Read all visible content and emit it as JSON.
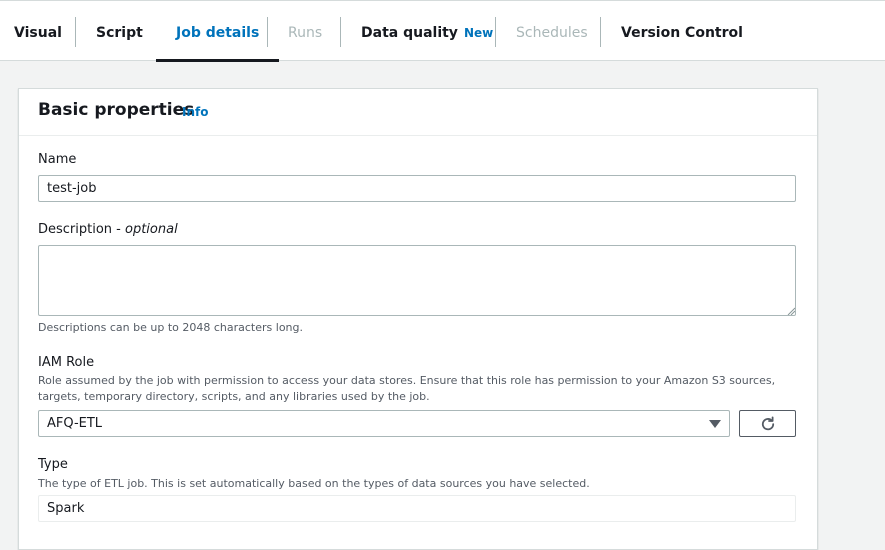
{
  "tabs": [
    {
      "label": "Visual",
      "state": "normal"
    },
    {
      "label": "Script",
      "state": "normal"
    },
    {
      "label": "Job details",
      "state": "active"
    },
    {
      "label": "Runs",
      "state": "disabled"
    },
    {
      "label": "Data quality",
      "state": "normal",
      "badge": "New"
    },
    {
      "label": "Schedules",
      "state": "disabled"
    },
    {
      "label": "Version Control",
      "state": "normal"
    }
  ],
  "panel": {
    "title": "Basic properties",
    "info_link": "Info"
  },
  "form": {
    "name": {
      "label": "Name",
      "value": "test-job"
    },
    "description": {
      "label": "Description - ",
      "label_optional": "optional",
      "value": "",
      "hint": "Descriptions can be up to 2048 characters long."
    },
    "iam_role": {
      "label": "IAM Role",
      "hint": "Role assumed by the job with permission to access your data stores. Ensure that this role has permission to your Amazon S3 sources, targets, temporary directory, scripts, and any libraries used by the job.",
      "selected": "AFQ-ETL",
      "refresh_icon": "refresh-icon"
    },
    "type": {
      "label": "Type",
      "hint": "The type of ETL job. This is set automatically based on the types of data sources you have selected.",
      "value": "Spark"
    }
  },
  "colors": {
    "accent": "#0073bb",
    "text": "#16191f",
    "muted": "#545b64",
    "disabled": "#aab7b8",
    "background": "#f2f3f3"
  }
}
